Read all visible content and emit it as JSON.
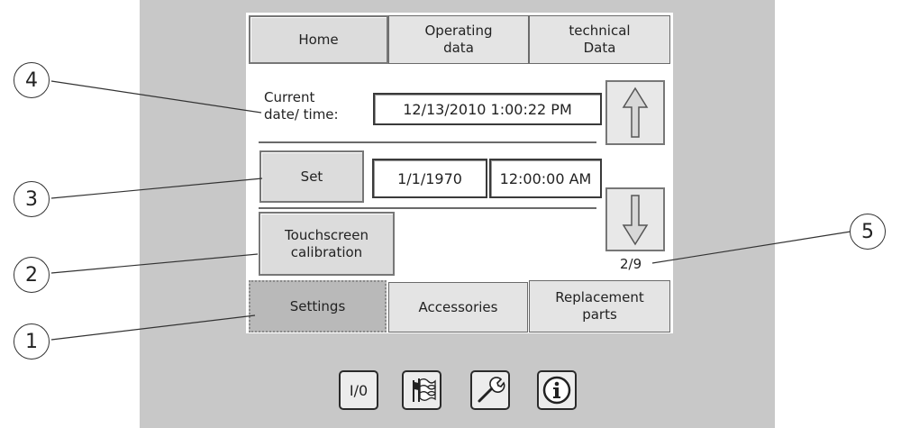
{
  "tabs_top": [
    {
      "label": "Home"
    },
    {
      "label": "Operating\ndata"
    },
    {
      "label": "technical\nData"
    }
  ],
  "datetime": {
    "label": "Current\ndate/ time:",
    "current_value": "12/13/2010 1:00:22 PM",
    "set_label": "Set",
    "set_date": "1/1/1970",
    "set_time": "12:00:00 AM"
  },
  "touchscreen_button": "Touchscreen\ncalibration",
  "page_indicator": "2/9",
  "tabs_bottom": [
    {
      "label": "Settings",
      "active": true
    },
    {
      "label": "Accessories"
    },
    {
      "label": "Replacement\nparts"
    }
  ],
  "toolbar": {
    "io_label": "I/0",
    "icons": [
      "io-icon",
      "language-flags-icon",
      "wrench-icon",
      "info-icon"
    ]
  },
  "callouts": [
    "1",
    "2",
    "3",
    "4",
    "5"
  ]
}
